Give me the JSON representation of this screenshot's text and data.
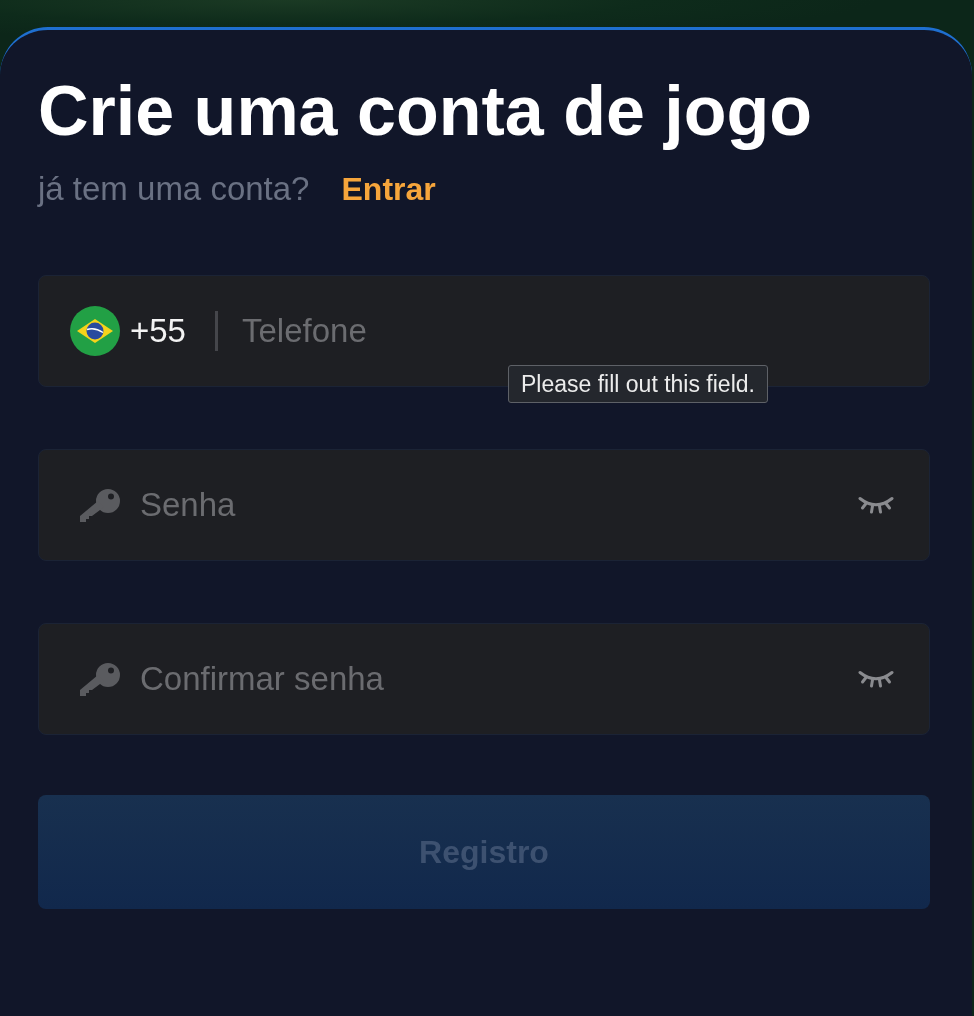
{
  "title": "Crie uma conta de jogo",
  "login_prompt": {
    "text": "já tem uma conta?",
    "link": "Entrar"
  },
  "phone_field": {
    "country_code": "+55",
    "placeholder": "Telefone"
  },
  "tooltip": "Please fill out this field.",
  "password_fields": [
    {
      "placeholder": "Senha",
      "visible": false
    },
    {
      "placeholder": "Confirmar senha",
      "visible": false
    }
  ],
  "register_button": {
    "label": "Registro",
    "disabled": true
  }
}
